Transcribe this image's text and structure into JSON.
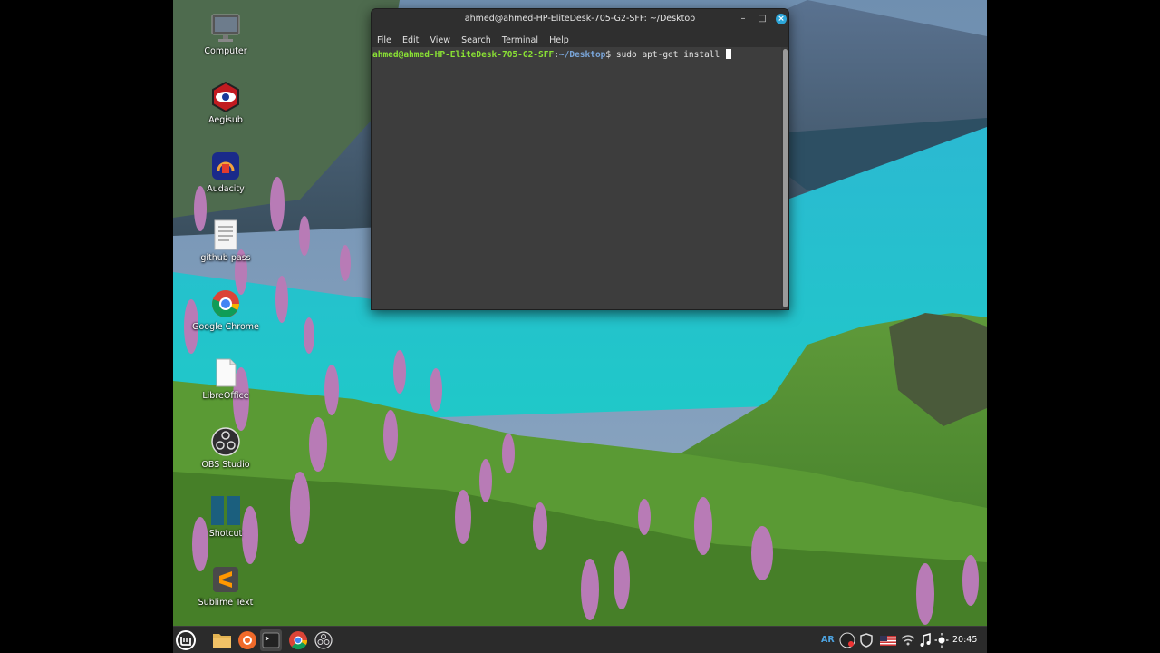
{
  "desktop": {
    "icons": [
      {
        "label": "Computer",
        "icon": "monitor-icon"
      },
      {
        "label": "Aegisub",
        "icon": "aegisub-icon"
      },
      {
        "label": "Audacity",
        "icon": "audacity-icon"
      },
      {
        "label": "github pass",
        "icon": "text-document-icon"
      },
      {
        "label": "Google Chrome",
        "icon": "chrome-icon"
      },
      {
        "label": "LibreOffice",
        "icon": "libreoffice-icon"
      },
      {
        "label": "OBS Studio",
        "icon": "obs-icon"
      },
      {
        "label": "Shotcut",
        "icon": "shotcut-icon"
      },
      {
        "label": "Sublime Text",
        "icon": "sublime-text-icon"
      }
    ]
  },
  "terminal": {
    "title": "ahmed@ahmed-HP-EliteDesk-705-G2-SFF: ~/Desktop",
    "menu": [
      "File",
      "Edit",
      "View",
      "Search",
      "Terminal",
      "Help"
    ],
    "prompt_user": "ahmed@ahmed-HP-EliteDesk-705-G2-SFF",
    "prompt_sep": ":",
    "prompt_path": "~/Desktop",
    "prompt_symbol": "$",
    "command": " sudo apt-get install "
  },
  "taskbar": {
    "keyboard_layout": "AR",
    "clock": "20:45",
    "apps": [
      "menu-icon",
      "files-icon",
      "firefox-icon",
      "terminal-icon",
      "chrome-icon",
      "obs-icon"
    ]
  },
  "colors": {
    "prompt_user": "#8ae234",
    "prompt_path": "#7aa6da",
    "close_button": "#2da6d9"
  }
}
